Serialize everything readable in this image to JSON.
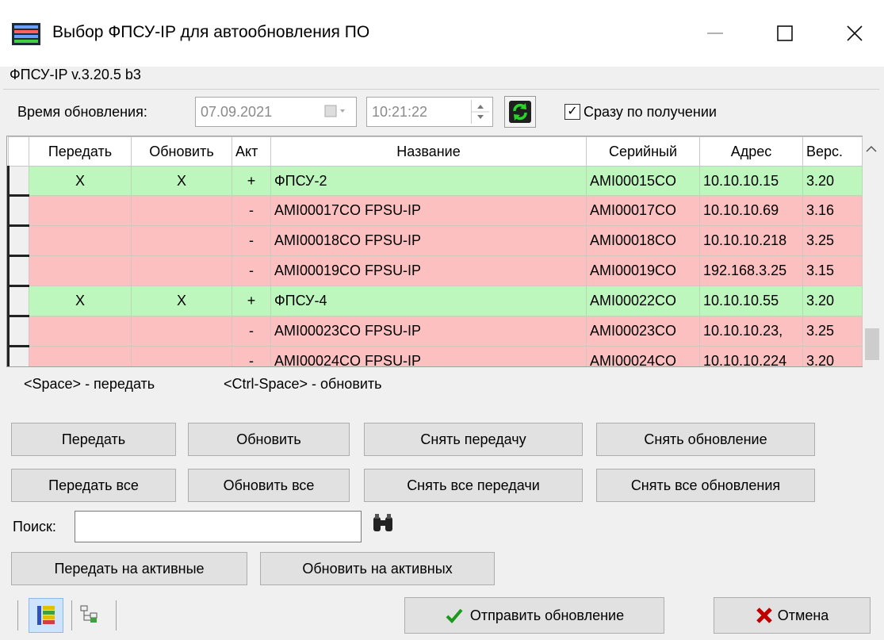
{
  "window": {
    "title": "Выбор ФПСУ-IP для автообновления ПО"
  },
  "version_label": "ФПСУ-IP v.3.20.5 b3",
  "update_time": {
    "label": "Время обновления:",
    "date": "07.09.2021",
    "time": "10:21:22",
    "immediately_label": "Сразу по получении",
    "immediately_checked": true
  },
  "grid": {
    "columns": [
      "Передать",
      "Обновить",
      "Акт",
      "Название",
      "Серийный",
      "Адрес",
      "Верс."
    ],
    "rows": [
      {
        "send": "X",
        "update": "X",
        "act": "+",
        "name": "ФПСУ-2",
        "serial": "AMI00015CO",
        "address": "10.10.10.15",
        "ver": "3.20",
        "active": true
      },
      {
        "send": "",
        "update": "",
        "act": "-",
        "name": "AMI00017CO FPSU-IP",
        "serial": "AMI00017CO",
        "address": "10.10.10.69",
        "ver": "3.16",
        "active": false
      },
      {
        "send": "",
        "update": "",
        "act": "-",
        "name": "AMI00018CO FPSU-IP",
        "serial": "AMI00018CO",
        "address": "10.10.10.218",
        "ver": "3.25",
        "active": false
      },
      {
        "send": "",
        "update": "",
        "act": "-",
        "name": "AMI00019CO FPSU-IP",
        "serial": "AMI00019CO",
        "address": "192.168.3.25",
        "ver": "3.15",
        "active": false
      },
      {
        "send": "X",
        "update": "X",
        "act": "+",
        "name": "ФПСУ-4",
        "serial": "AMI00022CO",
        "address": "10.10.10.55",
        "ver": "3.20",
        "active": true
      },
      {
        "send": "",
        "update": "",
        "act": "-",
        "name": "AMI00023CO FPSU-IP",
        "serial": "AMI00023CO",
        "address": "10.10.10.23,",
        "ver": "3.25",
        "active": false
      },
      {
        "send": "",
        "update": "",
        "act": "-",
        "name": "AMI00024CO FPSU-IP",
        "serial": "AMI00024CO",
        "address": "10.10.10.224",
        "ver": "3.20",
        "active": false
      }
    ]
  },
  "hints": {
    "space": "<Space> - передать",
    "ctrl_space": "<Ctrl-Space> - обновить"
  },
  "buttons": {
    "send": "Передать",
    "update": "Обновить",
    "cancel_send": "Снять передачу",
    "cancel_update": "Снять обновление",
    "send_all": "Передать все",
    "update_all": "Обновить все",
    "cancel_all_sends": "Снять все передачи",
    "cancel_all_updates": "Снять все обновления",
    "send_active": "Передать на активные",
    "update_active": "Обновить на активных",
    "submit": "Отправить обновление",
    "cancel": "Отмена"
  },
  "search": {
    "label": "Поиск:",
    "value": ""
  },
  "icons": [
    "app-icon",
    "minimize-icon",
    "maximize-icon",
    "close-icon",
    "calendar-icon",
    "refresh-icon",
    "binoculars-icon",
    "list-view-icon",
    "tree-view-icon",
    "check-icon",
    "cross-icon"
  ],
  "colors": {
    "active_row": "#bdf7bd",
    "inactive_row": "#fcc0c0",
    "refresh": "#1aa01a"
  }
}
